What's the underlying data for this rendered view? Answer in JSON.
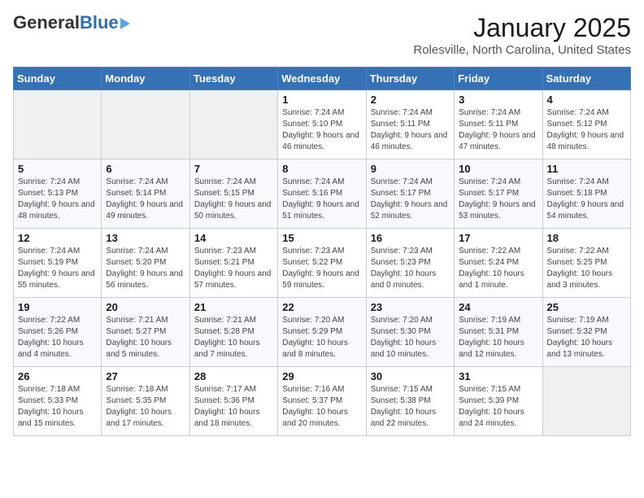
{
  "header": {
    "logo_general": "General",
    "logo_blue": "Blue",
    "title": "January 2025",
    "subtitle": "Rolesville, North Carolina, United States"
  },
  "weekdays": [
    "Sunday",
    "Monday",
    "Tuesday",
    "Wednesday",
    "Thursday",
    "Friday",
    "Saturday"
  ],
  "weeks": [
    [
      {
        "day": "",
        "info": ""
      },
      {
        "day": "",
        "info": ""
      },
      {
        "day": "",
        "info": ""
      },
      {
        "day": "1",
        "info": "Sunrise: 7:24 AM\nSunset: 5:10 PM\nDaylight: 9 hours and 46 minutes."
      },
      {
        "day": "2",
        "info": "Sunrise: 7:24 AM\nSunset: 5:11 PM\nDaylight: 9 hours and 46 minutes."
      },
      {
        "day": "3",
        "info": "Sunrise: 7:24 AM\nSunset: 5:11 PM\nDaylight: 9 hours and 47 minutes."
      },
      {
        "day": "4",
        "info": "Sunrise: 7:24 AM\nSunset: 5:12 PM\nDaylight: 9 hours and 48 minutes."
      }
    ],
    [
      {
        "day": "5",
        "info": "Sunrise: 7:24 AM\nSunset: 5:13 PM\nDaylight: 9 hours and 48 minutes."
      },
      {
        "day": "6",
        "info": "Sunrise: 7:24 AM\nSunset: 5:14 PM\nDaylight: 9 hours and 49 minutes."
      },
      {
        "day": "7",
        "info": "Sunrise: 7:24 AM\nSunset: 5:15 PM\nDaylight: 9 hours and 50 minutes."
      },
      {
        "day": "8",
        "info": "Sunrise: 7:24 AM\nSunset: 5:16 PM\nDaylight: 9 hours and 51 minutes."
      },
      {
        "day": "9",
        "info": "Sunrise: 7:24 AM\nSunset: 5:17 PM\nDaylight: 9 hours and 52 minutes."
      },
      {
        "day": "10",
        "info": "Sunrise: 7:24 AM\nSunset: 5:17 PM\nDaylight: 9 hours and 53 minutes."
      },
      {
        "day": "11",
        "info": "Sunrise: 7:24 AM\nSunset: 5:18 PM\nDaylight: 9 hours and 54 minutes."
      }
    ],
    [
      {
        "day": "12",
        "info": "Sunrise: 7:24 AM\nSunset: 5:19 PM\nDaylight: 9 hours and 55 minutes."
      },
      {
        "day": "13",
        "info": "Sunrise: 7:24 AM\nSunset: 5:20 PM\nDaylight: 9 hours and 56 minutes."
      },
      {
        "day": "14",
        "info": "Sunrise: 7:23 AM\nSunset: 5:21 PM\nDaylight: 9 hours and 57 minutes."
      },
      {
        "day": "15",
        "info": "Sunrise: 7:23 AM\nSunset: 5:22 PM\nDaylight: 9 hours and 59 minutes."
      },
      {
        "day": "16",
        "info": "Sunrise: 7:23 AM\nSunset: 5:23 PM\nDaylight: 10 hours and 0 minutes."
      },
      {
        "day": "17",
        "info": "Sunrise: 7:22 AM\nSunset: 5:24 PM\nDaylight: 10 hours and 1 minute."
      },
      {
        "day": "18",
        "info": "Sunrise: 7:22 AM\nSunset: 5:25 PM\nDaylight: 10 hours and 3 minutes."
      }
    ],
    [
      {
        "day": "19",
        "info": "Sunrise: 7:22 AM\nSunset: 5:26 PM\nDaylight: 10 hours and 4 minutes."
      },
      {
        "day": "20",
        "info": "Sunrise: 7:21 AM\nSunset: 5:27 PM\nDaylight: 10 hours and 5 minutes."
      },
      {
        "day": "21",
        "info": "Sunrise: 7:21 AM\nSunset: 5:28 PM\nDaylight: 10 hours and 7 minutes."
      },
      {
        "day": "22",
        "info": "Sunrise: 7:20 AM\nSunset: 5:29 PM\nDaylight: 10 hours and 8 minutes."
      },
      {
        "day": "23",
        "info": "Sunrise: 7:20 AM\nSunset: 5:30 PM\nDaylight: 10 hours and 10 minutes."
      },
      {
        "day": "24",
        "info": "Sunrise: 7:19 AM\nSunset: 5:31 PM\nDaylight: 10 hours and 12 minutes."
      },
      {
        "day": "25",
        "info": "Sunrise: 7:19 AM\nSunset: 5:32 PM\nDaylight: 10 hours and 13 minutes."
      }
    ],
    [
      {
        "day": "26",
        "info": "Sunrise: 7:18 AM\nSunset: 5:33 PM\nDaylight: 10 hours and 15 minutes."
      },
      {
        "day": "27",
        "info": "Sunrise: 7:18 AM\nSunset: 5:35 PM\nDaylight: 10 hours and 17 minutes."
      },
      {
        "day": "28",
        "info": "Sunrise: 7:17 AM\nSunset: 5:36 PM\nDaylight: 10 hours and 18 minutes."
      },
      {
        "day": "29",
        "info": "Sunrise: 7:16 AM\nSunset: 5:37 PM\nDaylight: 10 hours and 20 minutes."
      },
      {
        "day": "30",
        "info": "Sunrise: 7:15 AM\nSunset: 5:38 PM\nDaylight: 10 hours and 22 minutes."
      },
      {
        "day": "31",
        "info": "Sunrise: 7:15 AM\nSunset: 5:39 PM\nDaylight: 10 hours and 24 minutes."
      },
      {
        "day": "",
        "info": ""
      }
    ]
  ]
}
